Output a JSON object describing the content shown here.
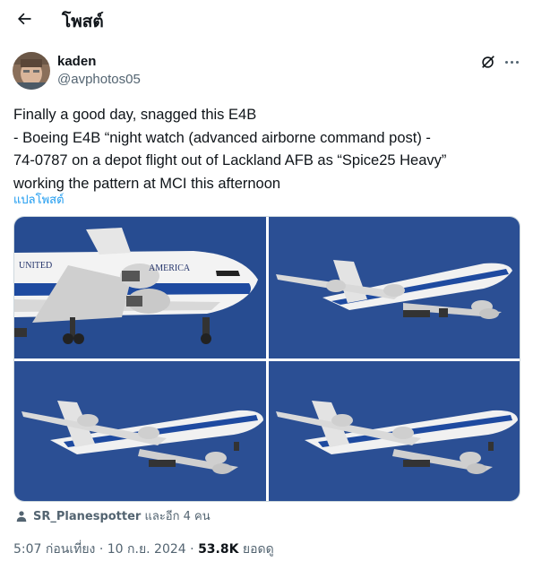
{
  "header": {
    "title": "โพสต์",
    "back_icon": "arrow-left-icon"
  },
  "author": {
    "name": "kaden",
    "handle": "@avphotos05"
  },
  "tweet": {
    "lines": [
      "Finally a good day, snagged this E4B",
      "- Boeing E4B “night watch (advanced airborne command post) -",
      "74-0787 on a depot flight out of Lackland AFB as “Spice25 Heavy”",
      "working the pattern at MCI this afternoon"
    ],
    "translate_label": "แปลโพสต์"
  },
  "media": {
    "count": 4,
    "sky_color": "#2b4f94"
  },
  "retweet": {
    "user": "SR_Planespotter",
    "suffix": " และอีก 4 คน"
  },
  "meta": {
    "time": "5:07 ก่อนเที่ยง",
    "separator": " · ",
    "date": "10 ก.ย. 2024",
    "views": "53.8K",
    "views_label": " ยอดดู"
  }
}
